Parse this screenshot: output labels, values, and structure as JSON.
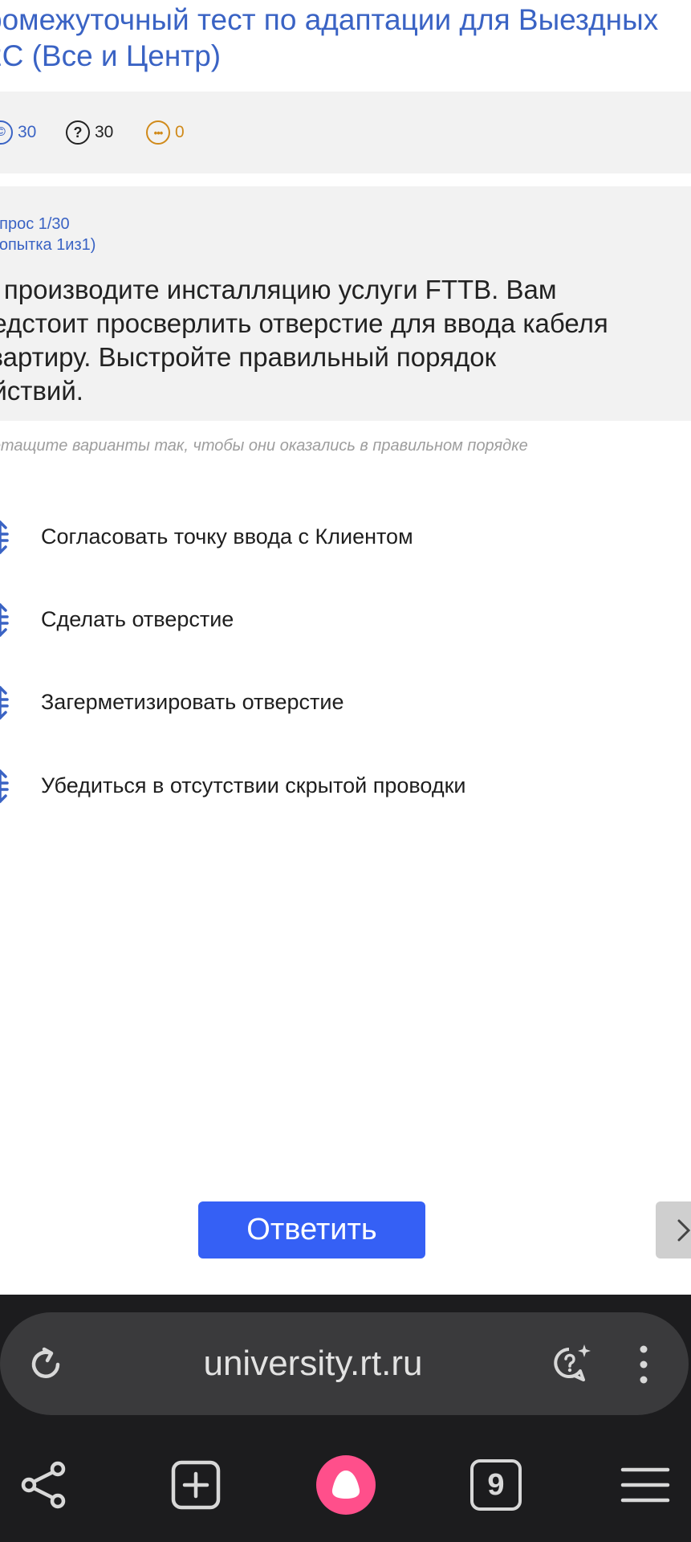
{
  "header": {
    "title": "ромежуточный тест по адаптации для Выездных\n2С (Все и Центр)"
  },
  "stats": {
    "correct": "30",
    "questions": "30",
    "unanswered": "0"
  },
  "question": {
    "number": "опрос 1/30",
    "attempt": "попытка 1из1)",
    "text": "ы производите инсталляцию услуги FTTB. Вам\nредстоит просверлить отверстие для ввода кабеля\n квартиру. Выстройте правильный порядок\nействий."
  },
  "hint": "етащите варианты так, чтобы они оказались в правильном порядке",
  "answers": [
    "Согласовать точку ввода с Клиентом",
    "Сделать отверстие",
    "Загерметизировать отверстие",
    "Убедиться в отсутствии скрытой проводки"
  ],
  "buttons": {
    "submit": "Ответить"
  },
  "browser": {
    "url": "university.rt.ru",
    "tab_count": "9"
  },
  "colors": {
    "accent_blue": "#3560f5",
    "link_blue": "#3a63c4",
    "warning_orange": "#d08a1a",
    "browser_bg": "#1c1c1e",
    "alice_pink": "#ff4f8b"
  }
}
